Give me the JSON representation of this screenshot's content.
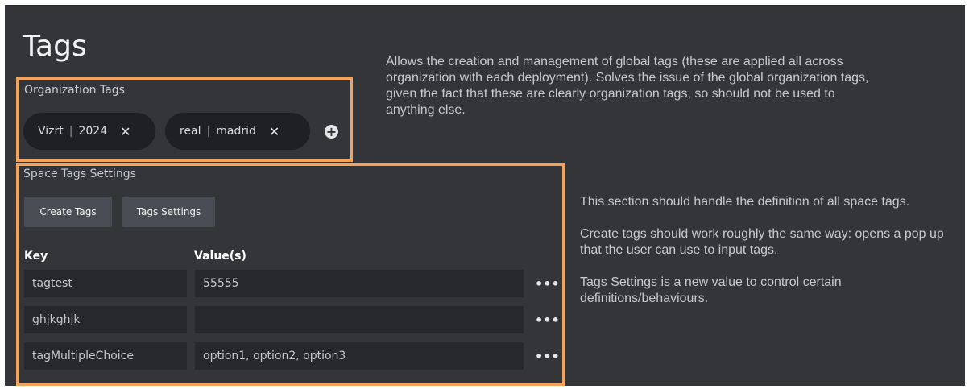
{
  "page": {
    "title": "Tags"
  },
  "organization": {
    "label": "Organization Tags",
    "tags": [
      {
        "key": "Vizrt",
        "value": "2024"
      },
      {
        "key": "real",
        "value": "madrid"
      }
    ],
    "remove_glyph": "✕",
    "separator": "|",
    "add_icon": "plus-circle-icon",
    "description": "Allows the creation and management of global tags (these are applied all across organization with each deployment). Solves the issue of the global organization tags, given the fact that these are clearly organization tags, so should not be used to anything else."
  },
  "space": {
    "label": "Space Tags Settings",
    "buttons": {
      "create": "Create Tags",
      "settings": "Tags Settings"
    },
    "columns": {
      "key": "Key",
      "value": "Value(s)"
    },
    "rows": [
      {
        "key": "tagtest",
        "value": "55555"
      },
      {
        "key": "ghjkghjk",
        "value": ""
      },
      {
        "key": "tagMultipleChoice",
        "value": "option1, option2, option3"
      }
    ],
    "more_glyph": "•••",
    "description": [
      "This section should handle the definition of all space tags.",
      "Create tags should work roughly the same way: opens a pop up that the user can use to input tags.",
      "Tags Settings is a new value to control certain definitions/behaviours."
    ]
  },
  "colors": {
    "panel_bg": "#333539",
    "annotation_outline": "#f5a35b",
    "chip_bg": "#1e2024",
    "cell_bg": "#26282c",
    "button_bg": "#4a4d53"
  }
}
